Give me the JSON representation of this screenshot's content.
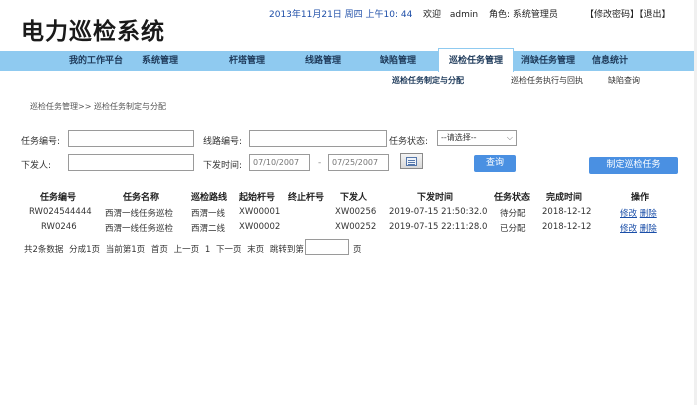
{
  "header": {
    "app_title": "电力巡检系统",
    "datetime": "2013年11月21日 周四 上午10: 44",
    "welcome_label": "欢迎",
    "username": "admin",
    "role_label": "角色:",
    "role": "系统管理员",
    "change_password": "【修改密码】",
    "logout": "【退出】"
  },
  "nav": {
    "items": [
      {
        "label": "我的工作平台"
      },
      {
        "label": "系统管理"
      },
      {
        "label": "杆塔管理"
      },
      {
        "label": "线路管理"
      },
      {
        "label": "缺陷管理"
      },
      {
        "label": "巡检任务管理"
      },
      {
        "label": "消缺任务管理"
      },
      {
        "label": "信息统计"
      }
    ],
    "active": "巡检任务管理"
  },
  "subnav": {
    "items": [
      {
        "label": "巡检任务制定与分配"
      },
      {
        "label": "巡检任务执行与回执"
      },
      {
        "label": "缺陷查询"
      }
    ]
  },
  "breadcrumb": "巡检任务管理>> 巡检任务制定与分配",
  "form": {
    "task_no_label": "任务编号:",
    "task_no_value": "",
    "line_no_label": "线路编号:",
    "line_no_value": "",
    "status_label": "任务状态:",
    "status_selected": "--请选择--",
    "issuer_label": "下发人:",
    "issuer_value": "",
    "issue_time_label": "下发时间:",
    "date_from_placeholder": "07/10/2007",
    "date_sep": "-",
    "date_to_placeholder": "07/25/2007",
    "query_button": "查询",
    "create_button": "制定巡检任务"
  },
  "table": {
    "columns": [
      "任务编号",
      "任务名称",
      "巡检路线",
      "起始杆号",
      "终止杆号",
      "下发人",
      "下发时间",
      "任务状态",
      "完成时间",
      "操作"
    ],
    "rows": [
      {
        "task_no": "RW024544444",
        "name": "西渭一线任务巡检",
        "route": "西渭一线",
        "start_pole": "XW00001",
        "end_pole": "",
        "issuer": "XW00256",
        "issue_time": "2019-07-15 21:50:32.0",
        "status": "待分配",
        "finish_time": "2018-12-12",
        "edit": "修改",
        "delete": "删除"
      },
      {
        "task_no": "RW0246",
        "name": "西渭一线任务巡检",
        "route": "西渭二线",
        "start_pole": "XW00002",
        "end_pole": "",
        "issuer": "XW00252",
        "issue_time": "2019-07-15 22:11:28.0",
        "status": "已分配",
        "finish_time": "2018-12-12",
        "edit": "修改",
        "delete": "删除"
      }
    ]
  },
  "pager": {
    "total": "共2条数据",
    "pages": "分成1页",
    "current": "当前第1页",
    "first": "首页",
    "prev": "上一页",
    "page_num": "1",
    "next": "下一页",
    "last": "末页",
    "jump_label": "跳转到第",
    "unit": "页"
  }
}
